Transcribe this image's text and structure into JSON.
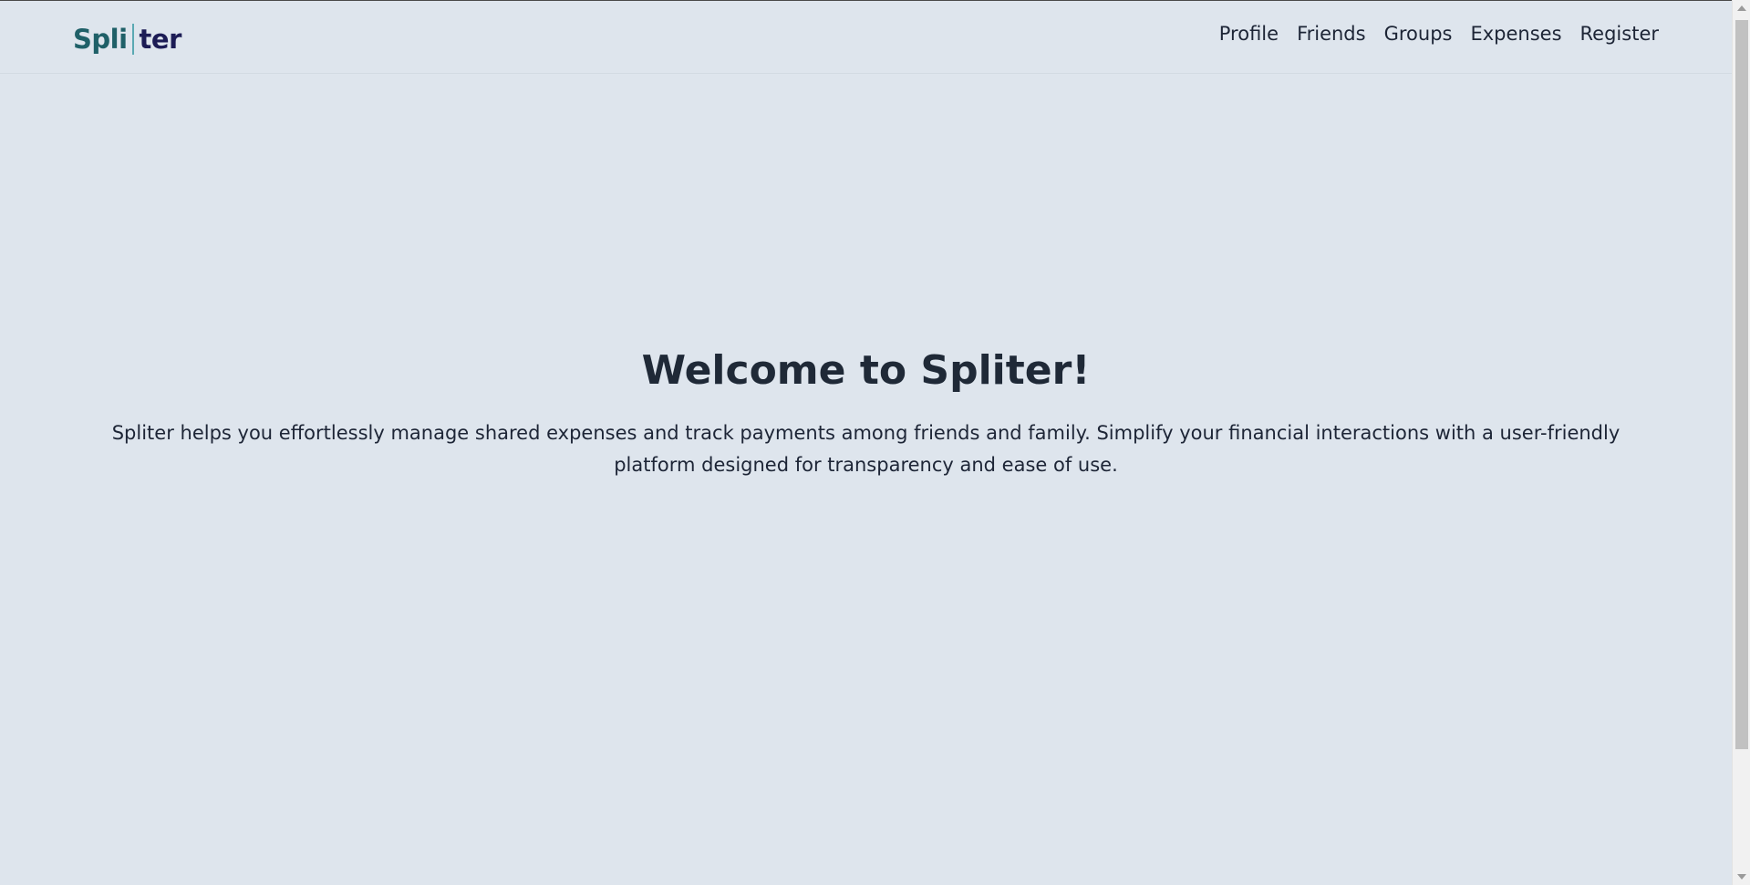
{
  "brand": {
    "part_a": "Spli",
    "part_b": "ter"
  },
  "nav": {
    "items": [
      {
        "label": "Profile"
      },
      {
        "label": "Friends"
      },
      {
        "label": "Groups"
      },
      {
        "label": "Expenses"
      },
      {
        "label": "Register"
      }
    ]
  },
  "hero": {
    "title": "Welcome to Spliter!",
    "description": "Spliter helps you effortlessly manage shared expenses and track payments among friends and family. Simplify your financial interactions with a user-friendly platform designed for transparency and ease of use."
  },
  "colors": {
    "background": "#dee5ed",
    "brand_primary": "#1f6068",
    "brand_secondary": "#1c1c55",
    "text": "#1d2536"
  }
}
